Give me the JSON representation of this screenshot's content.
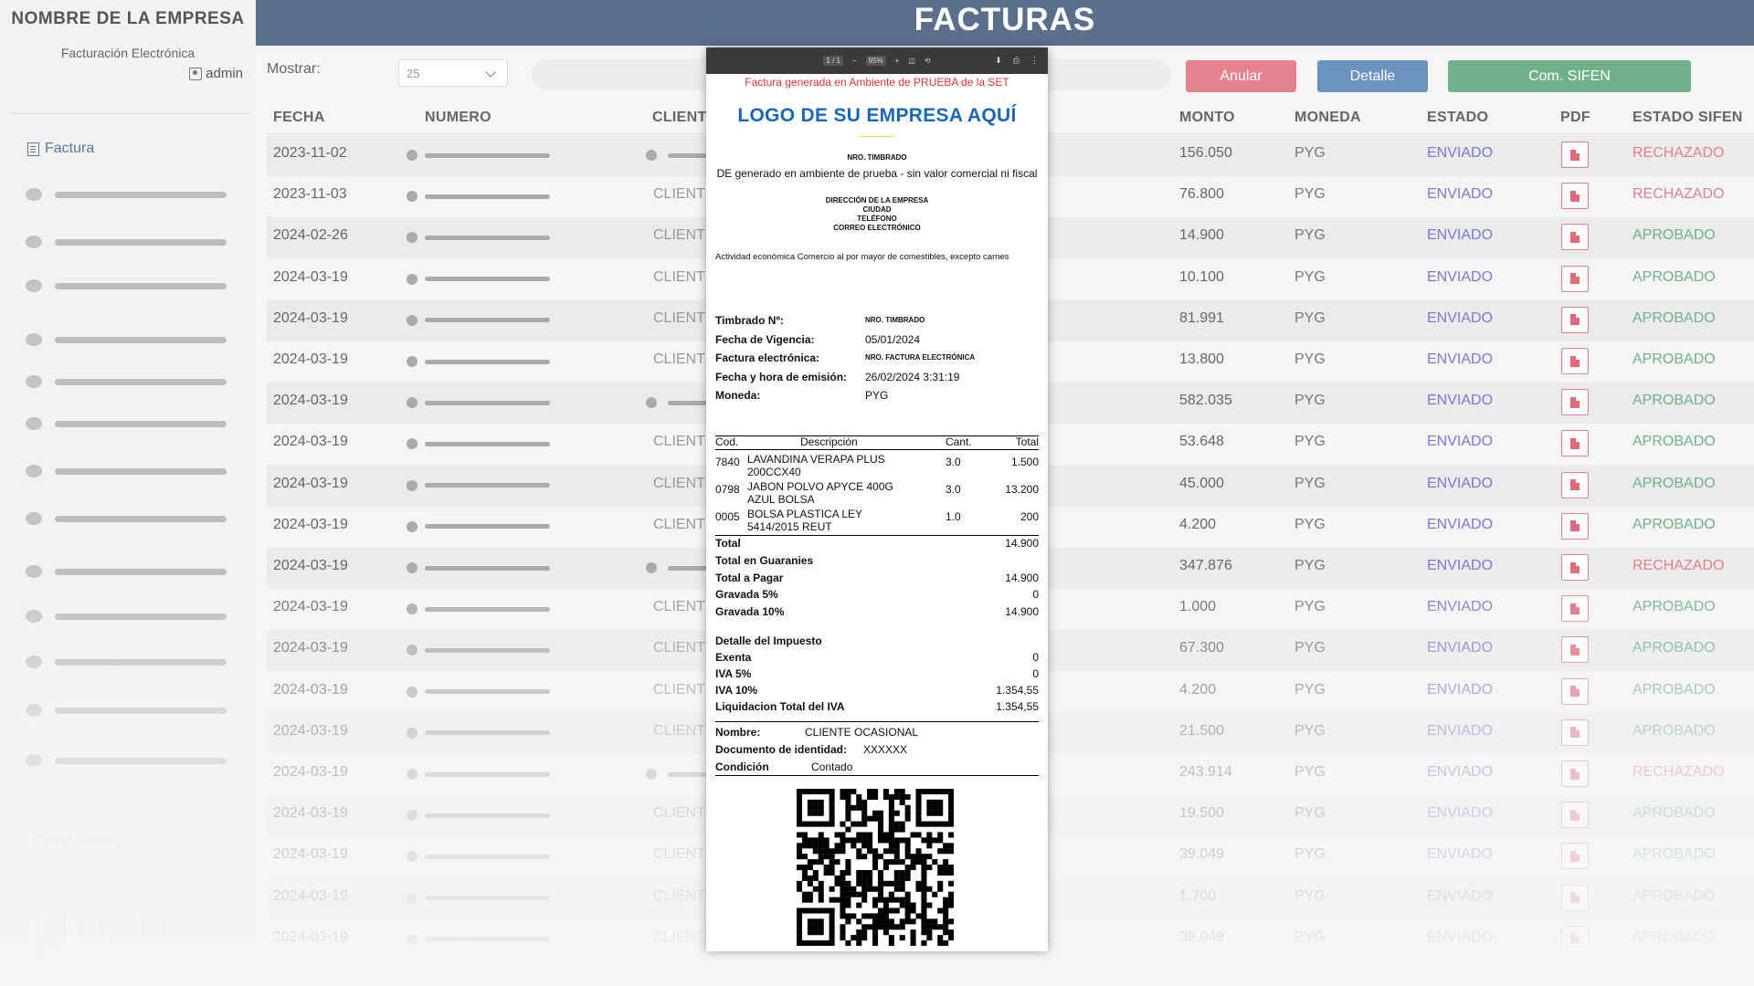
{
  "sidebar": {
    "company": "NOMBRE DE LA EMPRESA",
    "subtitle": "Facturación Electrónica",
    "user": "admin",
    "menu_factura": "Factura",
    "logout": "Cerrar Sesión"
  },
  "header": {
    "title": "FACTURAS"
  },
  "controls": {
    "mostrar_label": "Mostrar:",
    "page_size": "25",
    "btn_anular": "Anular",
    "btn_detalle": "Detalle",
    "btn_sifen": "Com. SIFEN"
  },
  "table": {
    "headers": [
      "FECHA",
      "NUMERO",
      "CLIENT",
      "MONTO",
      "MONEDA",
      "ESTADO",
      "PDF",
      "ESTADO SIFEN"
    ],
    "rows": [
      {
        "fecha": "2023-11-02",
        "cliente": "",
        "monto": "156.050",
        "moneda": "PYG",
        "estado": "ENVIADO",
        "sifen": "RECHAZADO"
      },
      {
        "fecha": "2023-11-03",
        "cliente": "CLIENT",
        "monto": "76.800",
        "moneda": "PYG",
        "estado": "ENVIADO",
        "sifen": "RECHAZADO"
      },
      {
        "fecha": "2024-02-26",
        "cliente": "CLIENT",
        "monto": "14.900",
        "moneda": "PYG",
        "estado": "ENVIADO",
        "sifen": "APROBADO"
      },
      {
        "fecha": "2024-03-19",
        "cliente": "CLIENT",
        "monto": "10.100",
        "moneda": "PYG",
        "estado": "ENVIADO",
        "sifen": "APROBADO"
      },
      {
        "fecha": "2024-03-19",
        "cliente": "CLIENT",
        "monto": "81.991",
        "moneda": "PYG",
        "estado": "ENVIADO",
        "sifen": "APROBADO"
      },
      {
        "fecha": "2024-03-19",
        "cliente": "CLIENT",
        "monto": "13.800",
        "moneda": "PYG",
        "estado": "ENVIADO",
        "sifen": "APROBADO"
      },
      {
        "fecha": "2024-03-19",
        "cliente": "",
        "monto": "582.035",
        "moneda": "PYG",
        "estado": "ENVIADO",
        "sifen": "APROBADO"
      },
      {
        "fecha": "2024-03-19",
        "cliente": "CLIENT",
        "monto": "53.648",
        "moneda": "PYG",
        "estado": "ENVIADO",
        "sifen": "APROBADO"
      },
      {
        "fecha": "2024-03-19",
        "cliente": "CLIENT",
        "monto": "45.000",
        "moneda": "PYG",
        "estado": "ENVIADO",
        "sifen": "APROBADO"
      },
      {
        "fecha": "2024-03-19",
        "cliente": "CLIENT",
        "monto": "4.200",
        "moneda": "PYG",
        "estado": "ENVIADO",
        "sifen": "APROBADO"
      },
      {
        "fecha": "2024-03-19",
        "cliente": "",
        "monto": "347.876",
        "moneda": "PYG",
        "estado": "ENVIADO",
        "sifen": "RECHAZADO"
      },
      {
        "fecha": "2024-03-19",
        "cliente": "CLIENT",
        "monto": "1.000",
        "moneda": "PYG",
        "estado": "ENVIADO",
        "sifen": "APROBADO"
      },
      {
        "fecha": "2024-03-19",
        "cliente": "CLIENT",
        "monto": "67.300",
        "moneda": "PYG",
        "estado": "ENVIADO",
        "sifen": "APROBADO"
      },
      {
        "fecha": "2024-03-19",
        "cliente": "CLIENT",
        "monto": "4.200",
        "moneda": "PYG",
        "estado": "ENVIADO",
        "sifen": "APROBADO"
      },
      {
        "fecha": "2024-03-19",
        "cliente": "CLIENT",
        "monto": "21.500",
        "moneda": "PYG",
        "estado": "ENVIADO",
        "sifen": "APROBADO"
      },
      {
        "fecha": "2024-03-19",
        "cliente": "",
        "monto": "243.914",
        "moneda": "PYG",
        "estado": "ENVIADO",
        "sifen": "RECHAZADO"
      },
      {
        "fecha": "2024-03-19",
        "cliente": "CLIENT",
        "monto": "19.500",
        "moneda": "PYG",
        "estado": "ENVIADO",
        "sifen": "APROBADO"
      },
      {
        "fecha": "2024-03-19",
        "cliente": "CLIENT",
        "monto": "39.049",
        "moneda": "PYG",
        "estado": "ENVIADO",
        "sifen": "APROBADO"
      },
      {
        "fecha": "2024-03-19",
        "cliente": "CLIENT",
        "monto": "1.700",
        "moneda": "PYG",
        "estado": "ENVIADO",
        "sifen": "APROBADO"
      },
      {
        "fecha": "2024-03-19",
        "cliente": "CLIENT",
        "monto": "39.049",
        "moneda": "PYG",
        "estado": "ENVIADO",
        "sifen": "APROBADO"
      }
    ]
  },
  "viewer": {
    "page": "1 / 1",
    "zoom": "95%",
    "warning": "Factura generada en Ambiente de PRUEBA de la SET",
    "logo": "LOGO DE SU EMPRESA AQUÍ",
    "nro_timbrado_top": "NRO. TIMBRADO",
    "disclaimer": "DE generado en ambiente de prueba - sin valor comercial ni fiscal",
    "direccion": "DIRECCIÓN DE LA EMPRESA",
    "ciudad": "CIUDAD",
    "telefono": "TELÉFONO",
    "correo": "CORREO ELECTRÓNICO",
    "actividad": "Actividad económica Comercio al por mayor de comestibles, excepto carnes",
    "info": [
      {
        "label": "Timbrado Nº:",
        "value": "NRO. TIMBRADO"
      },
      {
        "label": "Fecha de Vigencia:",
        "value": "05/01/2024"
      },
      {
        "label": "Factura electrónica:",
        "value": "NRO. FACTURA ELECTRÓNICA"
      },
      {
        "label": "Fecha y hora de emisión:",
        "value": "26/02/2024 3:31:19"
      },
      {
        "label": "Moneda:",
        "value": "PYG"
      }
    ],
    "items_header": {
      "cod": "Cod.",
      "desc": "Descripción",
      "cant": "Cant.",
      "total": "Total"
    },
    "items": [
      {
        "cod": "7840",
        "desc1": "LAVANDINA VERAPA PLUS",
        "desc2": "200CCX40",
        "cant": "3.0",
        "total": "1.500"
      },
      {
        "cod": "0798",
        "desc1": "JABON POLVO APYCE 400G",
        "desc2": "AZUL BOLSA",
        "cant": "3.0",
        "total": "13.200"
      },
      {
        "cod": "0005",
        "desc1": "BOLSA PLASTICA LEY",
        "desc2": "5414/2015 REUT",
        "cant": "1.0",
        "total": "200"
      }
    ],
    "totals": [
      {
        "label": "Total",
        "value": "14.900"
      },
      {
        "label": "Total en Guaranies",
        "value": ""
      },
      {
        "label": "Total a Pagar",
        "value": "14.900"
      },
      {
        "label": "Gravada 5%",
        "value": "0"
      },
      {
        "label": "Gravada 10%",
        "value": "14.900"
      }
    ],
    "impuesto_title": "Detalle del Impuesto",
    "impuesto": [
      {
        "label": "Exenta",
        "value": "0"
      },
      {
        "label": "IVA 5%",
        "value": "0"
      },
      {
        "label": "IVA 10%",
        "value": "1.354,55"
      },
      {
        "label": "Liquidacion Total del IVA",
        "value": "1.354,55"
      }
    ],
    "cliente": [
      {
        "label": "Nombre:",
        "value": "CLIENTE OCASIONAL"
      },
      {
        "label": "Documento de identidad:",
        "value": "XXXXXX"
      },
      {
        "label": "Condición",
        "value": "Contado"
      }
    ]
  },
  "colors": {
    "header": "#5b6e8c",
    "anular": "#e4828d",
    "detalle": "#6c93c0",
    "sifen": "#6fb188",
    "enviado": "#7b78d4",
    "rechazado": "#e77f8a",
    "aprobado": "#6fb188",
    "logo": "#1b66b6",
    "warning": "#e0342f"
  }
}
